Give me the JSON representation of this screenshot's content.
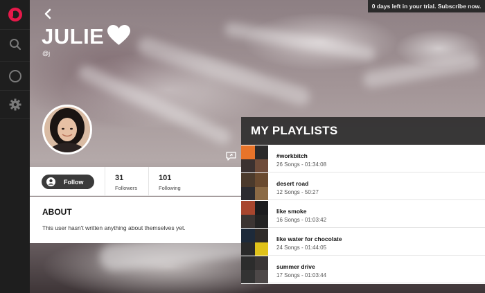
{
  "sidebar": {
    "items": [
      {
        "name": "beats-logo-icon"
      },
      {
        "name": "search-icon"
      },
      {
        "name": "radio-icon"
      },
      {
        "name": "settings-icon"
      }
    ]
  },
  "trial_banner": "0 days left in your trial. Subscribe now.",
  "profile": {
    "name": "JULIE",
    "handle": "@j",
    "follow_label": "Follow",
    "followers_count": "31",
    "followers_label": "Followers",
    "following_count": "101",
    "following_label": "Following"
  },
  "about": {
    "title": "ABOUT",
    "text": "This user hasn't written anything about themselves yet."
  },
  "playlists": {
    "title": "MY PLAYLISTS",
    "items": [
      {
        "title": "#workbitch",
        "meta": "26 Songs - 01:34:08",
        "colors": [
          "#e8742a",
          "#2b2a2a",
          "#3b3130",
          "#6f4c3a"
        ]
      },
      {
        "title": "desert road",
        "meta": "12 Songs - 50:27",
        "colors": [
          "#4b3a2c",
          "#6a4a2f",
          "#2c2c30",
          "#8b6a45"
        ]
      },
      {
        "title": "like smoke",
        "meta": "16 Songs - 01:03:42",
        "colors": [
          "#a8462e",
          "#1c1c1e",
          "#3c3533",
          "#232323"
        ]
      },
      {
        "title": "like water for chocolate",
        "meta": "24 Songs - 01:44:05",
        "colors": [
          "#1d2a3a",
          "#2f2b29",
          "#2a2a2a",
          "#e0c21a"
        ]
      },
      {
        "title": "summer drive",
        "meta": "17 Songs - 01:03:44",
        "colors": [
          "#2c2c2c",
          "#3a3636",
          "#333333",
          "#4d4848"
        ]
      }
    ]
  },
  "colors": {
    "accent": "#e6194a",
    "sidebar_bg": "#1e1e1e"
  }
}
